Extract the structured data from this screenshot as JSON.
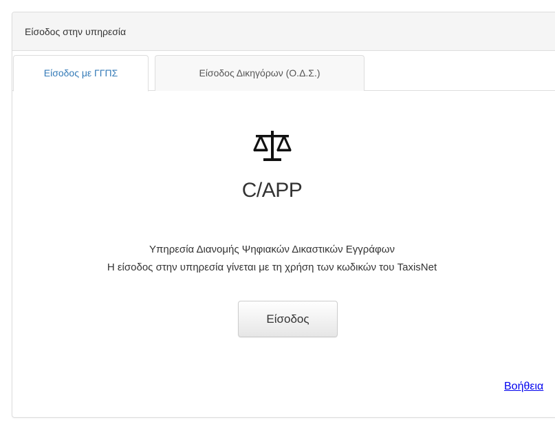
{
  "panel": {
    "title": "Είσοδος στην υπηρεσία"
  },
  "tabs": [
    {
      "label": "Είσοδος με ΓΓΠΣ",
      "active": true
    },
    {
      "label": "Είσοδος Δικηγόρων (Ο.Δ.Σ.)",
      "active": false
    }
  ],
  "main": {
    "icon": "balance-scale-icon",
    "app_name": "C/APP",
    "description_line1": "Υπηρεσία Διανομής Ψηφιακών Δικαστικών Εγγράφων",
    "description_line2": "Η είσοδος στην υπηρεσία γίνεται με τη χρήση των κωδικών του TaxisNet",
    "login_button_label": "Είσοδος",
    "help_link_label": "Βοήθεια"
  },
  "colors": {
    "active_tab_text": "#337ab7",
    "link": "#0000ee",
    "panel_heading_bg": "#f5f5f5",
    "border": "#dddddd"
  }
}
